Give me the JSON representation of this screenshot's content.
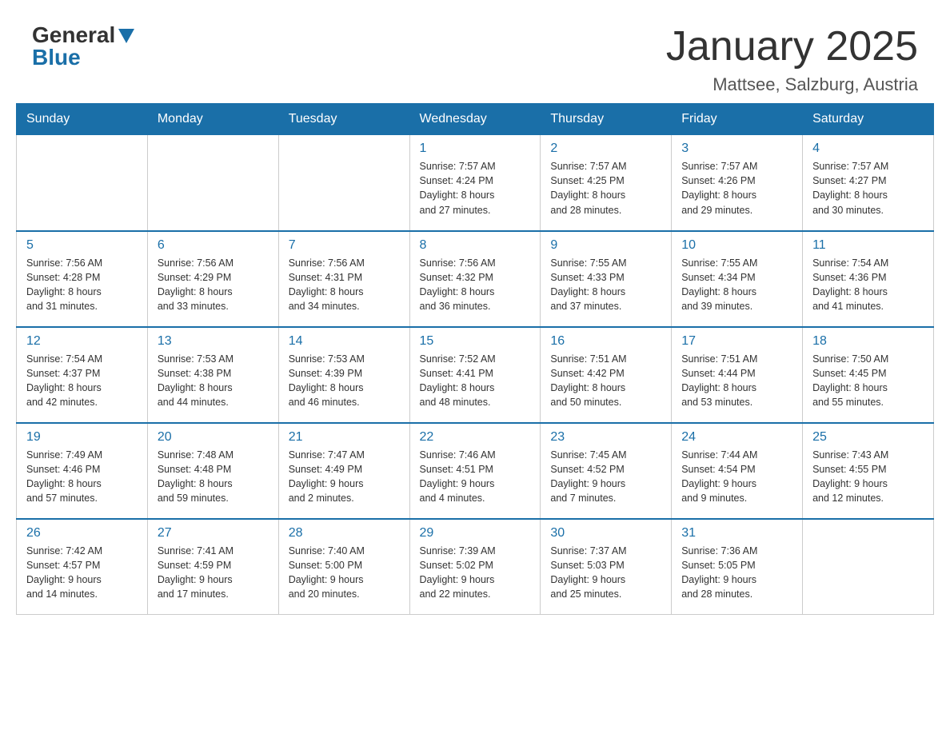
{
  "header": {
    "logo_general": "General",
    "logo_blue": "Blue",
    "title": "January 2025",
    "subtitle": "Mattsee, Salzburg, Austria"
  },
  "weekdays": [
    "Sunday",
    "Monday",
    "Tuesday",
    "Wednesday",
    "Thursday",
    "Friday",
    "Saturday"
  ],
  "weeks": [
    [
      {
        "day": "",
        "info": ""
      },
      {
        "day": "",
        "info": ""
      },
      {
        "day": "",
        "info": ""
      },
      {
        "day": "1",
        "info": "Sunrise: 7:57 AM\nSunset: 4:24 PM\nDaylight: 8 hours\nand 27 minutes."
      },
      {
        "day": "2",
        "info": "Sunrise: 7:57 AM\nSunset: 4:25 PM\nDaylight: 8 hours\nand 28 minutes."
      },
      {
        "day": "3",
        "info": "Sunrise: 7:57 AM\nSunset: 4:26 PM\nDaylight: 8 hours\nand 29 minutes."
      },
      {
        "day": "4",
        "info": "Sunrise: 7:57 AM\nSunset: 4:27 PM\nDaylight: 8 hours\nand 30 minutes."
      }
    ],
    [
      {
        "day": "5",
        "info": "Sunrise: 7:56 AM\nSunset: 4:28 PM\nDaylight: 8 hours\nand 31 minutes."
      },
      {
        "day": "6",
        "info": "Sunrise: 7:56 AM\nSunset: 4:29 PM\nDaylight: 8 hours\nand 33 minutes."
      },
      {
        "day": "7",
        "info": "Sunrise: 7:56 AM\nSunset: 4:31 PM\nDaylight: 8 hours\nand 34 minutes."
      },
      {
        "day": "8",
        "info": "Sunrise: 7:56 AM\nSunset: 4:32 PM\nDaylight: 8 hours\nand 36 minutes."
      },
      {
        "day": "9",
        "info": "Sunrise: 7:55 AM\nSunset: 4:33 PM\nDaylight: 8 hours\nand 37 minutes."
      },
      {
        "day": "10",
        "info": "Sunrise: 7:55 AM\nSunset: 4:34 PM\nDaylight: 8 hours\nand 39 minutes."
      },
      {
        "day": "11",
        "info": "Sunrise: 7:54 AM\nSunset: 4:36 PM\nDaylight: 8 hours\nand 41 minutes."
      }
    ],
    [
      {
        "day": "12",
        "info": "Sunrise: 7:54 AM\nSunset: 4:37 PM\nDaylight: 8 hours\nand 42 minutes."
      },
      {
        "day": "13",
        "info": "Sunrise: 7:53 AM\nSunset: 4:38 PM\nDaylight: 8 hours\nand 44 minutes."
      },
      {
        "day": "14",
        "info": "Sunrise: 7:53 AM\nSunset: 4:39 PM\nDaylight: 8 hours\nand 46 minutes."
      },
      {
        "day": "15",
        "info": "Sunrise: 7:52 AM\nSunset: 4:41 PM\nDaylight: 8 hours\nand 48 minutes."
      },
      {
        "day": "16",
        "info": "Sunrise: 7:51 AM\nSunset: 4:42 PM\nDaylight: 8 hours\nand 50 minutes."
      },
      {
        "day": "17",
        "info": "Sunrise: 7:51 AM\nSunset: 4:44 PM\nDaylight: 8 hours\nand 53 minutes."
      },
      {
        "day": "18",
        "info": "Sunrise: 7:50 AM\nSunset: 4:45 PM\nDaylight: 8 hours\nand 55 minutes."
      }
    ],
    [
      {
        "day": "19",
        "info": "Sunrise: 7:49 AM\nSunset: 4:46 PM\nDaylight: 8 hours\nand 57 minutes."
      },
      {
        "day": "20",
        "info": "Sunrise: 7:48 AM\nSunset: 4:48 PM\nDaylight: 8 hours\nand 59 minutes."
      },
      {
        "day": "21",
        "info": "Sunrise: 7:47 AM\nSunset: 4:49 PM\nDaylight: 9 hours\nand 2 minutes."
      },
      {
        "day": "22",
        "info": "Sunrise: 7:46 AM\nSunset: 4:51 PM\nDaylight: 9 hours\nand 4 minutes."
      },
      {
        "day": "23",
        "info": "Sunrise: 7:45 AM\nSunset: 4:52 PM\nDaylight: 9 hours\nand 7 minutes."
      },
      {
        "day": "24",
        "info": "Sunrise: 7:44 AM\nSunset: 4:54 PM\nDaylight: 9 hours\nand 9 minutes."
      },
      {
        "day": "25",
        "info": "Sunrise: 7:43 AM\nSunset: 4:55 PM\nDaylight: 9 hours\nand 12 minutes."
      }
    ],
    [
      {
        "day": "26",
        "info": "Sunrise: 7:42 AM\nSunset: 4:57 PM\nDaylight: 9 hours\nand 14 minutes."
      },
      {
        "day": "27",
        "info": "Sunrise: 7:41 AM\nSunset: 4:59 PM\nDaylight: 9 hours\nand 17 minutes."
      },
      {
        "day": "28",
        "info": "Sunrise: 7:40 AM\nSunset: 5:00 PM\nDaylight: 9 hours\nand 20 minutes."
      },
      {
        "day": "29",
        "info": "Sunrise: 7:39 AM\nSunset: 5:02 PM\nDaylight: 9 hours\nand 22 minutes."
      },
      {
        "day": "30",
        "info": "Sunrise: 7:37 AM\nSunset: 5:03 PM\nDaylight: 9 hours\nand 25 minutes."
      },
      {
        "day": "31",
        "info": "Sunrise: 7:36 AM\nSunset: 5:05 PM\nDaylight: 9 hours\nand 28 minutes."
      },
      {
        "day": "",
        "info": ""
      }
    ]
  ]
}
